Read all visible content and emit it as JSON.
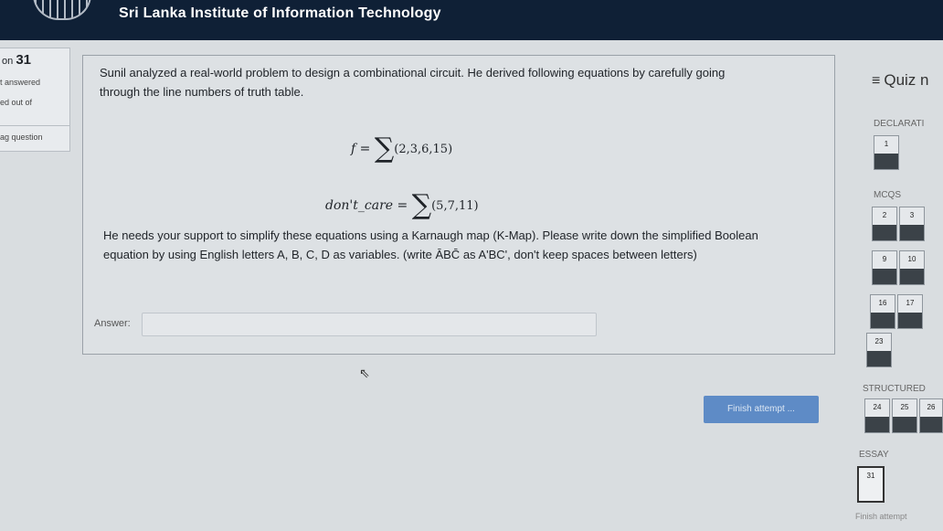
{
  "header": {
    "title": "Sri Lanka Institute of Information Technology"
  },
  "question_info": {
    "question_prefix": "on",
    "question_number": "31",
    "state": "t answered",
    "marked_out_of": "ed out of",
    "flag": "ag question"
  },
  "question": {
    "intro": "Sunil analyzed a real-world problem to design a combinational circuit. He derived following equations by carefully going through the line numbers of truth table.",
    "eq1_lhs": "f =",
    "eq1_sigma": "∑",
    "eq1_terms": "(2,3,6,15)",
    "eq2_lhs": "don't_care =",
    "eq2_sigma": "∑",
    "eq2_terms": "(5,7,11)",
    "instruction": "He needs your support to simplify these equations using a Karnaugh map (K-Map). Please write down the simplified Boolean equation by using English letters A, B, C, D as variables. (write",
    "example_notation": "ĀBC̄",
    "example_rest": "as A'BC', don't keep spaces between letters)",
    "answer_label": "Answer:",
    "answer_value": ""
  },
  "actions": {
    "finish_label": "Finish attempt ..."
  },
  "nav": {
    "title": "Quiz n",
    "menu_icon": "menu-icon",
    "sections": {
      "declaration": "DECLARATI",
      "mcqs": "MCQS",
      "structured": "STRUCTURED",
      "essay": "ESSAY"
    },
    "buttons": {
      "q1": "1",
      "q2": "2",
      "q3": "3",
      "q9": "9",
      "q10": "10",
      "q16": "16",
      "q17": "17",
      "q23": "23",
      "q24": "24",
      "q25": "25",
      "q26": "26",
      "q31": "31"
    },
    "finish_link": "Finish attempt"
  },
  "colors": {
    "topbar": "#0f2036",
    "button": "#5e8bc6",
    "answered_fill": "#3b4248"
  }
}
